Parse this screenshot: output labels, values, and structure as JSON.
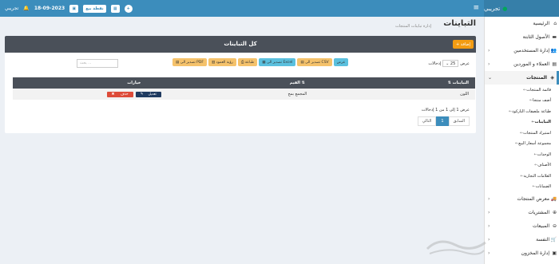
{
  "topbar": {
    "brand": "تجريبي",
    "date": "18-09-2023",
    "pos_button": "نقطة بيع",
    "user": "تجريبي"
  },
  "page": {
    "title": "التباينات",
    "subtitle": "إدارة تباينات المنتجات"
  },
  "box": {
    "title": "كل التباينات",
    "add_label": "إضافة"
  },
  "table_controls": {
    "length_prefix": "عرض",
    "length_value": "25",
    "length_suffix": "إدخالات",
    "search_placeholder": "بحث ...",
    "export_buttons": [
      {
        "label": "تصدير الى CSV",
        "color": "#f5c26b"
      },
      {
        "label": "تصدير الى Excel",
        "color": "#5bc0de"
      },
      {
        "label": "طباعة",
        "color": "#f5c26b"
      },
      {
        "label": "رؤية العمود",
        "color": "#f5c26b"
      },
      {
        "label": "تصدير الى PDF",
        "color": "#f5c26b"
      }
    ],
    "length_button": "عرض"
  },
  "table": {
    "headers": [
      "التباينات",
      "القيم",
      "خيارات"
    ],
    "rows": [
      {
        "name": "اللون",
        "values": "المجمع بمج",
        "edit": "تعديل",
        "delete": "حذف"
      }
    ]
  },
  "info_text": "عرض 1 إلى 1 من 1 إدخالات",
  "pager": {
    "prev": "السابق",
    "current": "1",
    "next": "التالي"
  },
  "sidebar": {
    "items_top": [
      {
        "label": "الرئيسية",
        "icon": "home-icon"
      },
      {
        "label": "الأصول الثابتة",
        "icon": "box-icon"
      },
      {
        "label": "إدارة المستخدمين",
        "icon": "users-icon"
      },
      {
        "label": "العملاء و الموردين",
        "icon": "address-book-icon"
      },
      {
        "label": "المنتجات",
        "icon": "cubes-icon"
      }
    ],
    "products_sub": [
      "قائمة المنتجات",
      "أضف منتجا",
      "طباعة ملصقات الباركود",
      "التباينات",
      "استيراد المنتجات",
      "مجموعة أسعار البيع",
      "الوحدات",
      "الأصناف",
      "العلامات التجارية",
      "الضمانات"
    ],
    "items_bottom": [
      {
        "label": "معرض المنتجات",
        "icon": "truck-icon"
      },
      {
        "label": "المشتريات",
        "icon": "download-icon"
      },
      {
        "label": "المبيعات",
        "icon": "upload-icon"
      },
      {
        "label": "النفسة",
        "icon": "cart-icon"
      },
      {
        "label": "إدارة المخزون",
        "icon": "warehouse-icon"
      }
    ]
  },
  "colors": {
    "primary": "#3c8dbc",
    "header_dark": "#4a5059",
    "accent": "#f39c12",
    "danger": "#dd4b39"
  }
}
